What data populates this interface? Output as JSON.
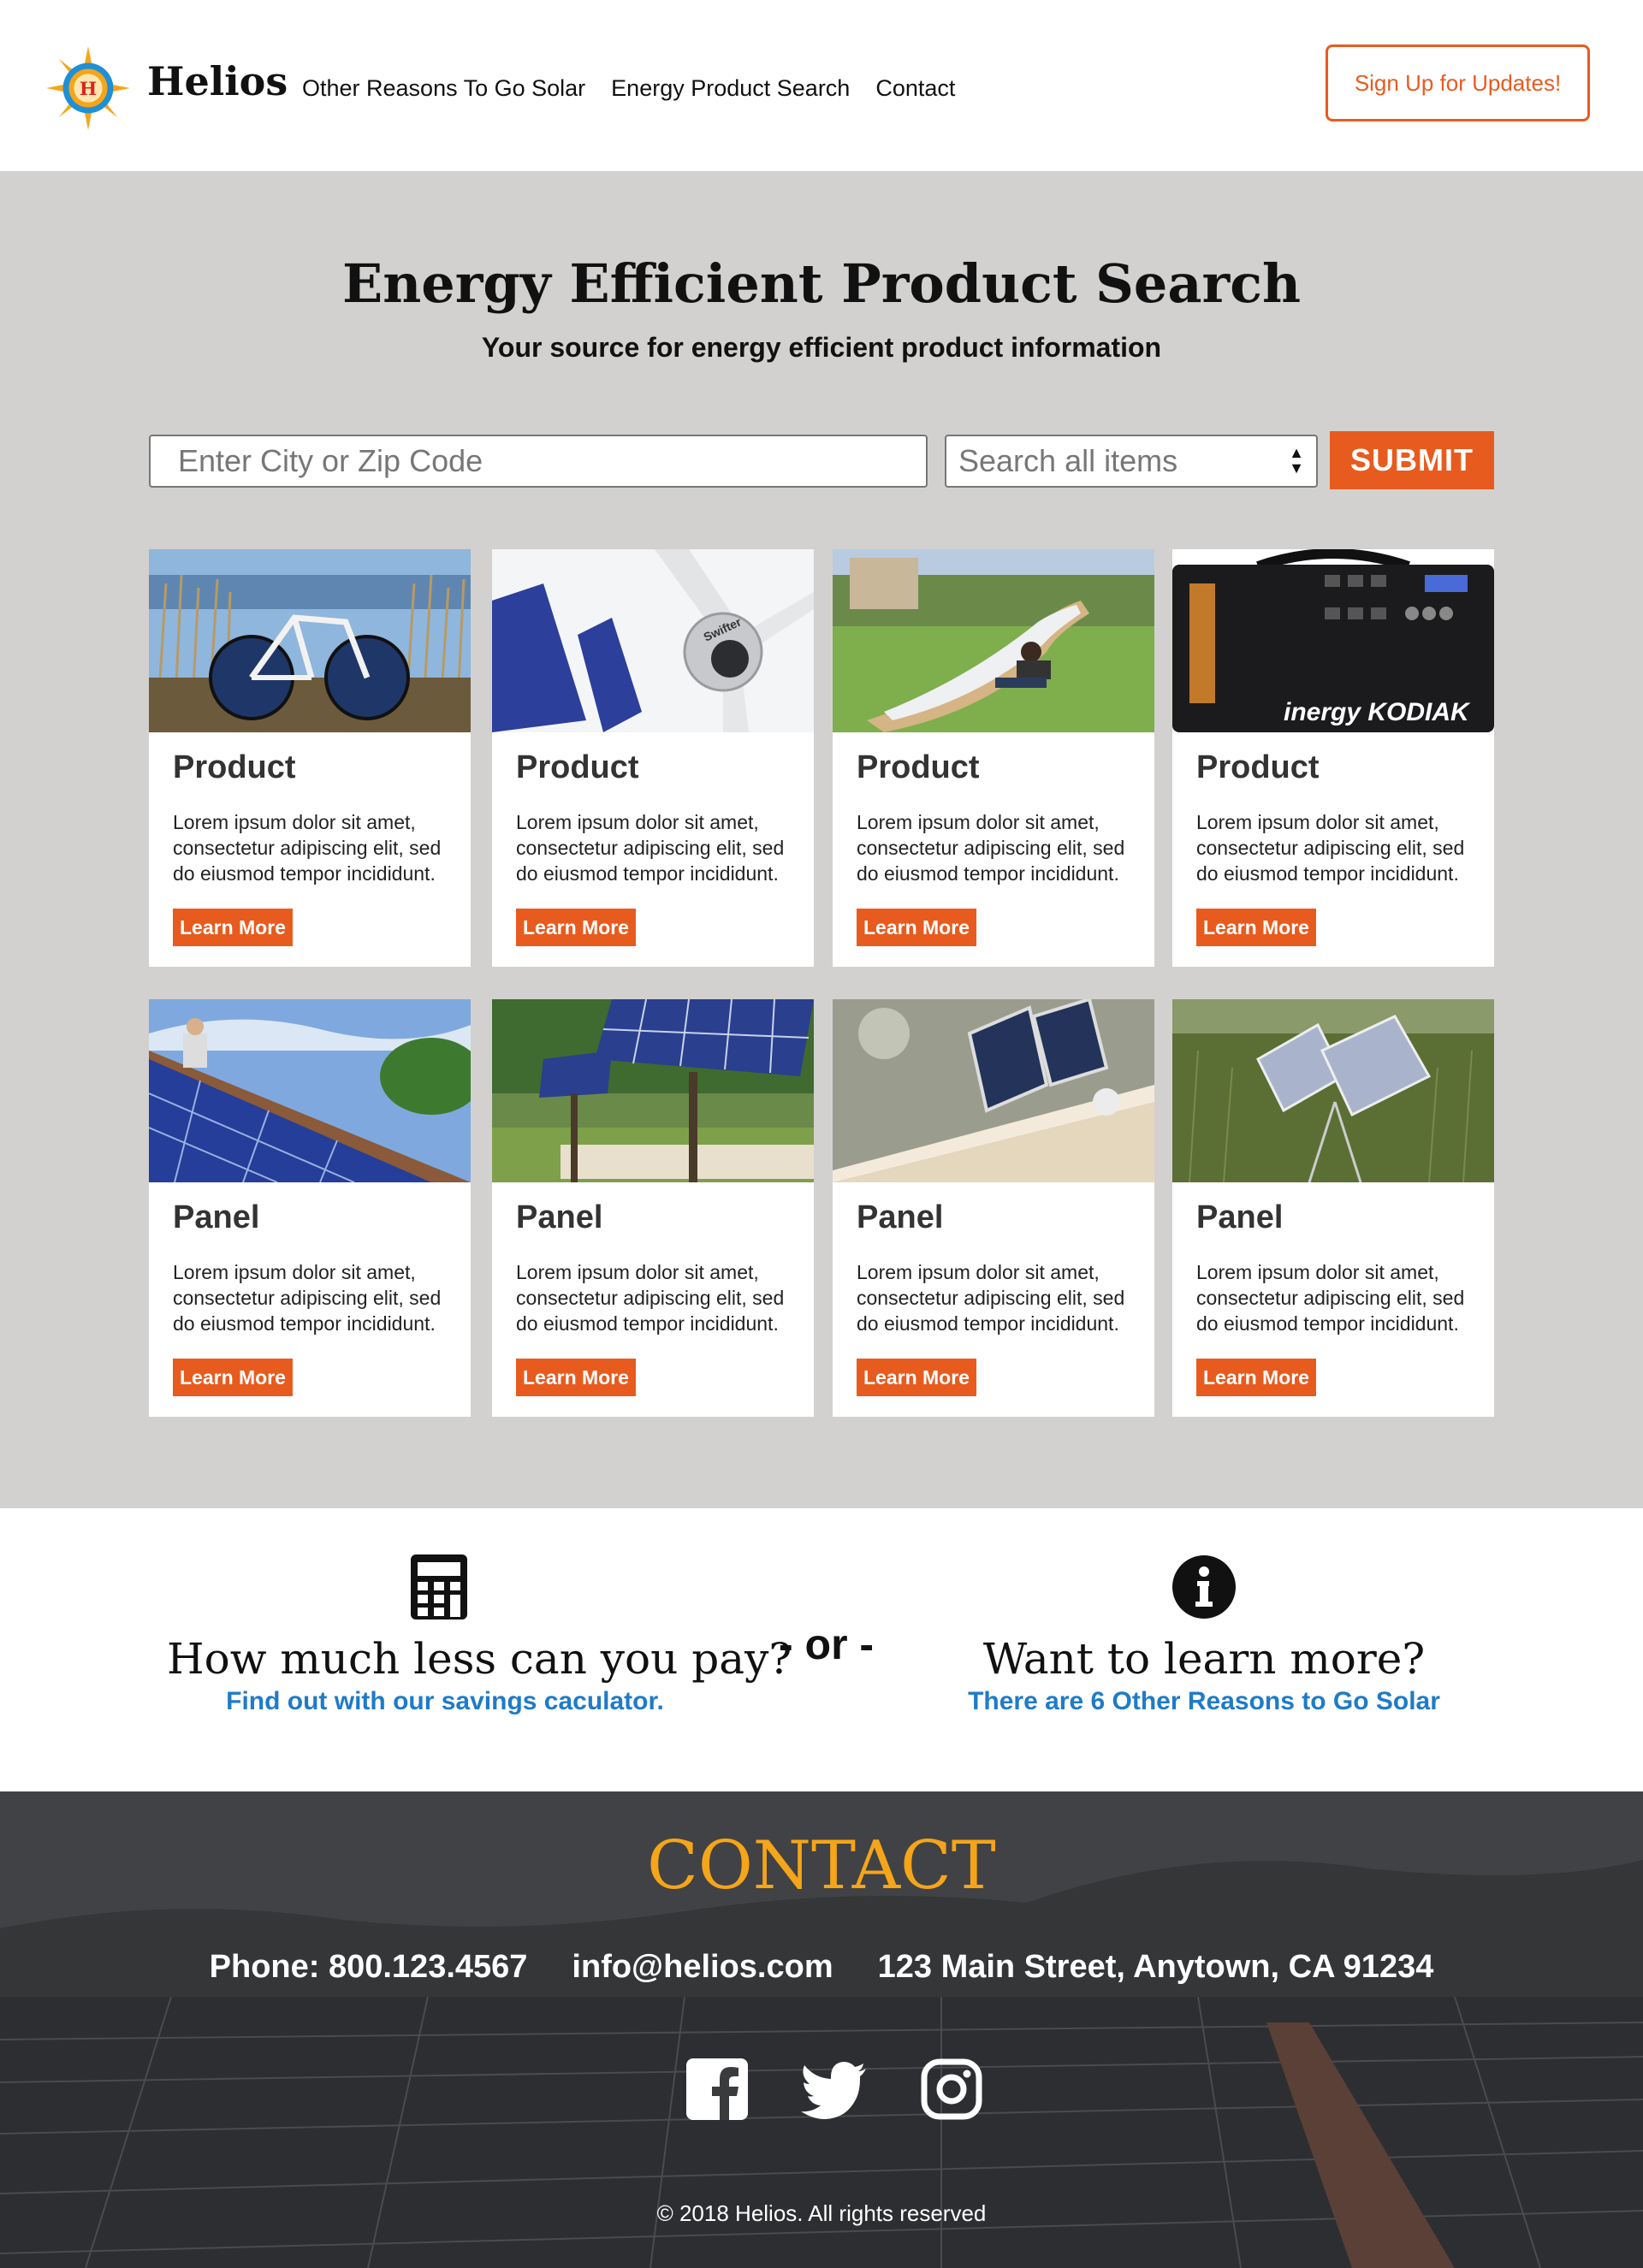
{
  "header": {
    "brand": "Helios",
    "logo_letter": "H",
    "nav": [
      "Other Reasons To Go Solar",
      "Energy Product Search",
      "Contact"
    ],
    "signup_label": "Sign Up for Updates!"
  },
  "search": {
    "title": "Energy Efficient Product Search",
    "subtitle": "Your source for energy efficient product information",
    "city_placeholder": "Enter City or Zip Code",
    "select_value": "Search all items",
    "submit_label": "SUBMIT"
  },
  "cards": [
    {
      "title": "Product",
      "text": "Lorem ipsum dolor sit amet, consectetur adipiscing elit, sed do eiusmod tempor incididunt.",
      "button": "Learn More",
      "image": "solar-bicycle"
    },
    {
      "title": "Product",
      "text": "Lorem ipsum dolor sit amet, consectetur adipiscing elit, sed do eiusmod tempor incididunt.",
      "button": "Learn More",
      "image": "solar-wind-turbine",
      "image_text": "Swifter"
    },
    {
      "title": "Product",
      "text": "Lorem ipsum dolor sit amet, consectetur adipiscing elit, sed do eiusmod tempor incididunt.",
      "button": "Learn More",
      "image": "solar-lounge-chair"
    },
    {
      "title": "Product",
      "text": "Lorem ipsum dolor sit amet, consectetur adipiscing elit, sed do eiusmod tempor incididunt.",
      "button": "Learn More",
      "image": "portable-power-station",
      "image_text": "inergy KODIAK"
    },
    {
      "title": "Panel",
      "text": "Lorem ipsum dolor sit amet, consectetur adipiscing elit, sed do eiusmod tempor incididunt.",
      "button": "Learn More",
      "image": "rooftop-solar-install"
    },
    {
      "title": "Panel",
      "text": "Lorem ipsum dolor sit amet, consectetur adipiscing elit, sed do eiusmod tempor incididunt.",
      "button": "Learn More",
      "image": "solar-tracker-array"
    },
    {
      "title": "Panel",
      "text": "Lorem ipsum dolor sit amet, consectetur adipiscing elit, sed do eiusmod tempor incididunt.",
      "button": "Learn More",
      "image": "solar-light-panels"
    },
    {
      "title": "Panel",
      "text": "Lorem ipsum dolor sit amet, consectetur adipiscing elit, sed do eiusmod tempor incididunt.",
      "button": "Learn More",
      "image": "field-solar-panels"
    }
  ],
  "cta": {
    "left_heading": "How much less can you pay?",
    "left_link": "Find out with our savings caculator.",
    "or": "- or -",
    "right_heading": "Want to learn more?",
    "right_link": "There are 6 Other Reasons to Go Solar",
    "left_icon": "calculator-icon",
    "right_icon": "info-icon"
  },
  "footer": {
    "heading": "CONTACT",
    "phone": "Phone: 800.123.4567",
    "email": "info@helios.com",
    "address": "123 Main Street, Anytown, CA 91234",
    "social": [
      "facebook-icon",
      "twitter-icon",
      "instagram-icon"
    ],
    "copyright": "© 2018 Helios. All rights reserved"
  },
  "colors": {
    "accent": "#e85b1f",
    "section_bg": "#d2d1cf",
    "link": "#1f7bc8",
    "contact_heading": "#f5a519",
    "footer_bg": "#3a3b3d"
  }
}
